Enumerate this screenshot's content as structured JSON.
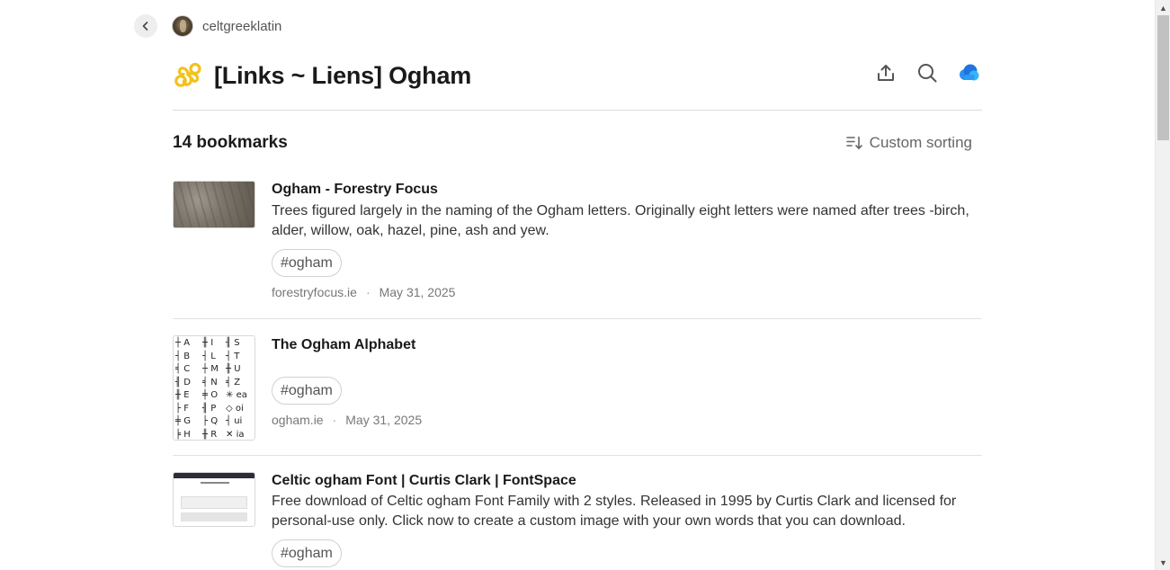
{
  "header": {
    "back_label": "Back",
    "username": "celtgreeklatin"
  },
  "collection": {
    "title": "[Links ~ Liens] Ogham",
    "icon": "triskele-icon",
    "icon_color": "#f2c21b"
  },
  "actions": {
    "share_icon": "share-upload-icon",
    "search_icon": "search-icon",
    "cloud_icon": "cloud-icon",
    "cloud_color": "#2d8ff0"
  },
  "list": {
    "count_label": "14 bookmarks",
    "sort_label": "Custom sorting"
  },
  "bookmarks": [
    {
      "title": "Ogham - Forestry Focus",
      "description": "Trees figured largely in the naming of the Ogham letters. Originally eight letters were named after trees -birch, alder, willow, oak, hazel, pine, ash and yew.",
      "tag": "#ogham",
      "domain": "forestryfocus.ie",
      "date": "May 31, 2025"
    },
    {
      "title": "The Ogham Alphabet",
      "description": "",
      "tag": "#ogham",
      "domain": "ogham.ie",
      "date": "May 31, 2025",
      "thumbnail_columns": [
        [
          "A",
          "B",
          "C",
          "D",
          "E",
          "F",
          "G",
          "H"
        ],
        [
          "I",
          "L",
          "M",
          "N",
          "O",
          "P",
          "Q",
          "R"
        ],
        [
          "S",
          "T",
          "U",
          "Z",
          "ea",
          "oi",
          "ui",
          "ia"
        ]
      ]
    },
    {
      "title": "Celtic ogham Font | Curtis Clark | FontSpace",
      "description": "Free download of Celtic ogham Font Family with 2 styles. Released in 1995 by Curtis Clark and licensed for personal-use only. Click now to create a custom image with your own words that you can download.",
      "tag": "#ogham"
    }
  ]
}
